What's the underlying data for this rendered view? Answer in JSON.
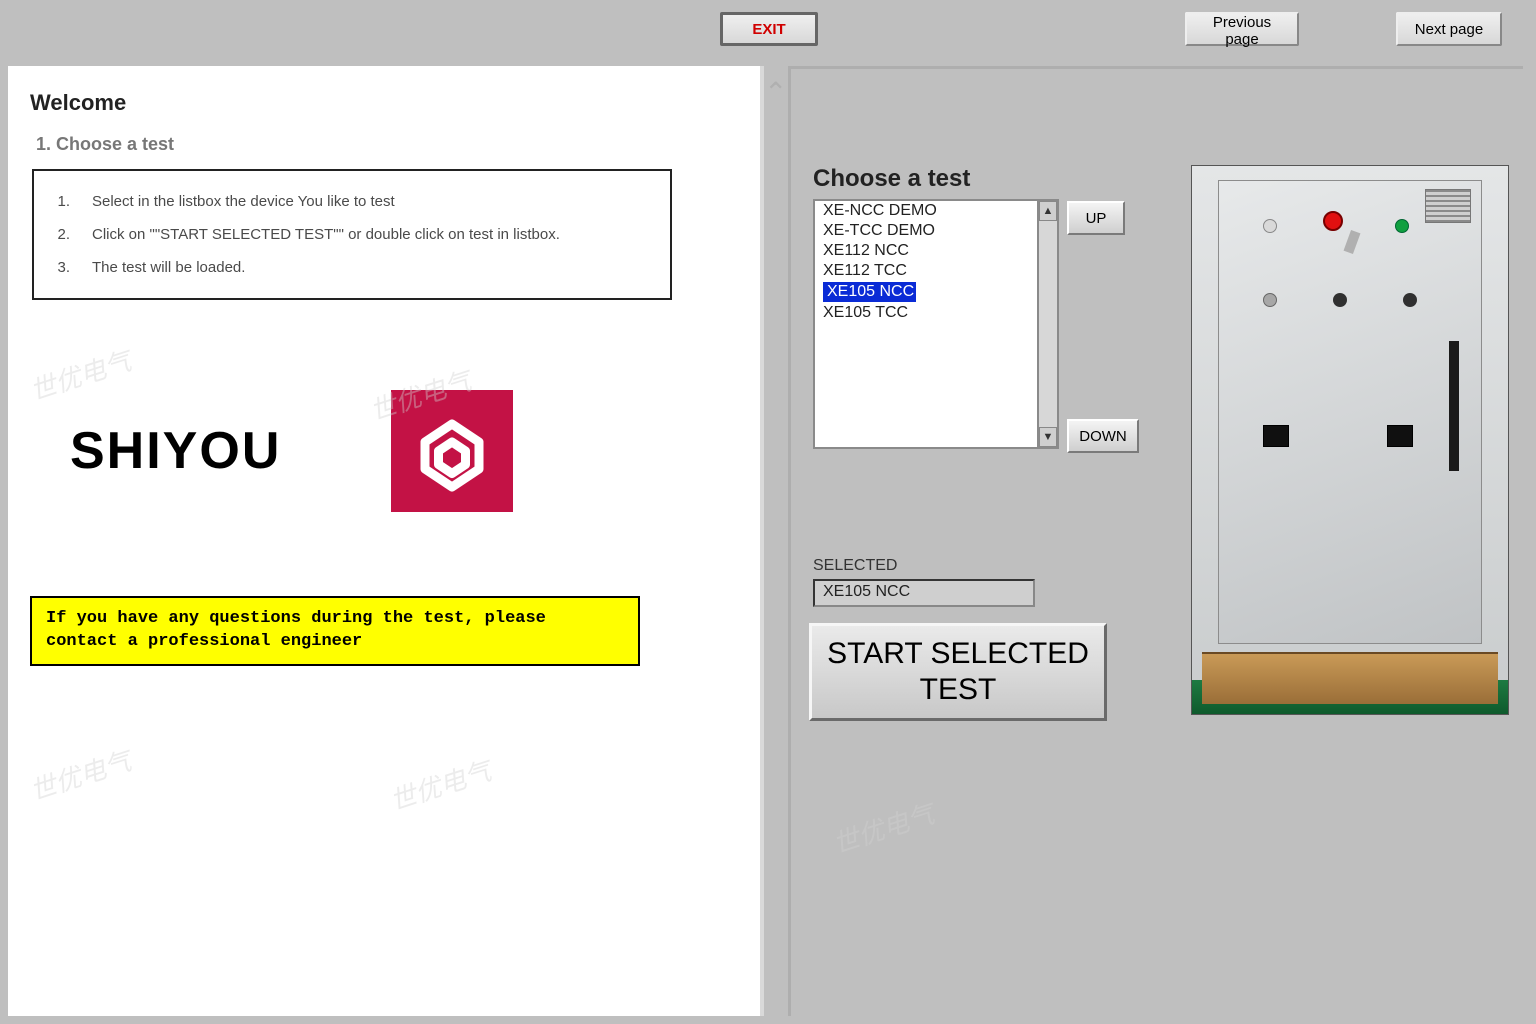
{
  "nav": {
    "exit": "EXIT",
    "prev": "Previous page",
    "next": "Next page"
  },
  "doc": {
    "welcome": "Welcome",
    "choose_heading": "1. Choose a test",
    "steps": [
      "Select in the listbox the device You like to test",
      "Click on \"\"START SELECTED TEST\"\" or double click on test in listbox.",
      "The test will be loaded."
    ],
    "brand": "SHIYOU",
    "warning": "If you have any questions during the test, please contact a professional engineer"
  },
  "right": {
    "choose_label": "Choose a test",
    "list": [
      "XE-NCC DEMO",
      "XE-TCC DEMO",
      "XE112 NCC",
      "XE112 TCC",
      "XE105 NCC",
      "XE105 TCC"
    ],
    "selected_index": 4,
    "up_btn": "UP",
    "down_btn": "DOWN",
    "selected_label": "SELECTED",
    "selected_value": "XE105 NCC",
    "start_btn": "START SELECTED TEST"
  },
  "watermark": "世优电气"
}
